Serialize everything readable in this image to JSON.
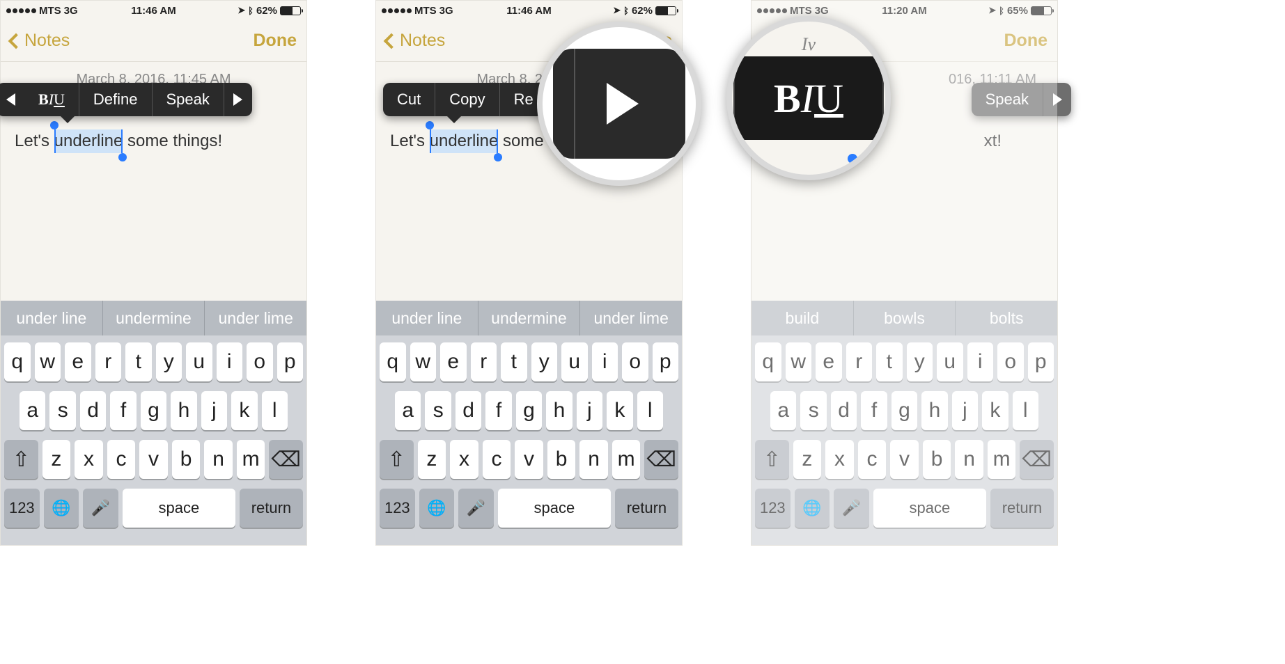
{
  "screens": [
    {
      "status": {
        "carrier": "MTS",
        "network": "3G",
        "time": "11:46 AM",
        "battery_pct": "62%",
        "signal_dots": 5
      },
      "nav": {
        "back": "Notes",
        "done": "Done"
      },
      "timestamp": "March 8, 2016, 11:45 AM",
      "note": {
        "pre": "Let's ",
        "sel": "underline",
        "post": " some things!"
      },
      "ctx": {
        "type": "page2",
        "items": [
          "B𝐼U",
          "Define",
          "Speak"
        ]
      },
      "suggestions": [
        "under line",
        "undermine",
        "under lime"
      ]
    },
    {
      "status": {
        "carrier": "MTS",
        "network": "3G",
        "time": "11:46 AM",
        "battery_pct": "62%",
        "signal_dots": 5
      },
      "nav": {
        "back": "Notes",
        "done": "Done"
      },
      "timestamp": "March 8, 2016, 1",
      "note": {
        "pre": "Let's ",
        "sel": "underline",
        "post": " some thin"
      },
      "ctx": {
        "type": "page1",
        "items": [
          "Cut",
          "Copy",
          "Re"
        ]
      },
      "suggestions": [
        "under line",
        "undermine",
        "under lime"
      ],
      "magnifier": "play"
    },
    {
      "status": {
        "carrier": "MTS",
        "network": "3G",
        "time": "11:20 AM",
        "battery_pct": "65%",
        "signal_dots": 5
      },
      "nav": {
        "back": "",
        "done": "Done"
      },
      "timestamp": "016, 11:11 AM",
      "note": {
        "pre": "",
        "sel": "",
        "post": "xt!"
      },
      "ctx": {
        "type": "gray",
        "items": [
          "Speak"
        ]
      },
      "suggestions": [
        "build",
        "bowls",
        "bolts"
      ],
      "magnifier": "biu",
      "faded": true
    }
  ],
  "keyboard": {
    "row1": [
      "q",
      "w",
      "e",
      "r",
      "t",
      "y",
      "u",
      "i",
      "o",
      "p"
    ],
    "row2": [
      "a",
      "s",
      "d",
      "f",
      "g",
      "h",
      "j",
      "k",
      "l"
    ],
    "row3": [
      "z",
      "x",
      "c",
      "v",
      "b",
      "n",
      "m"
    ],
    "space_label": "space",
    "return_label": "return",
    "num_label": "123"
  },
  "biu_fragment": "Iv",
  "mag_text_fragment": "xt!"
}
